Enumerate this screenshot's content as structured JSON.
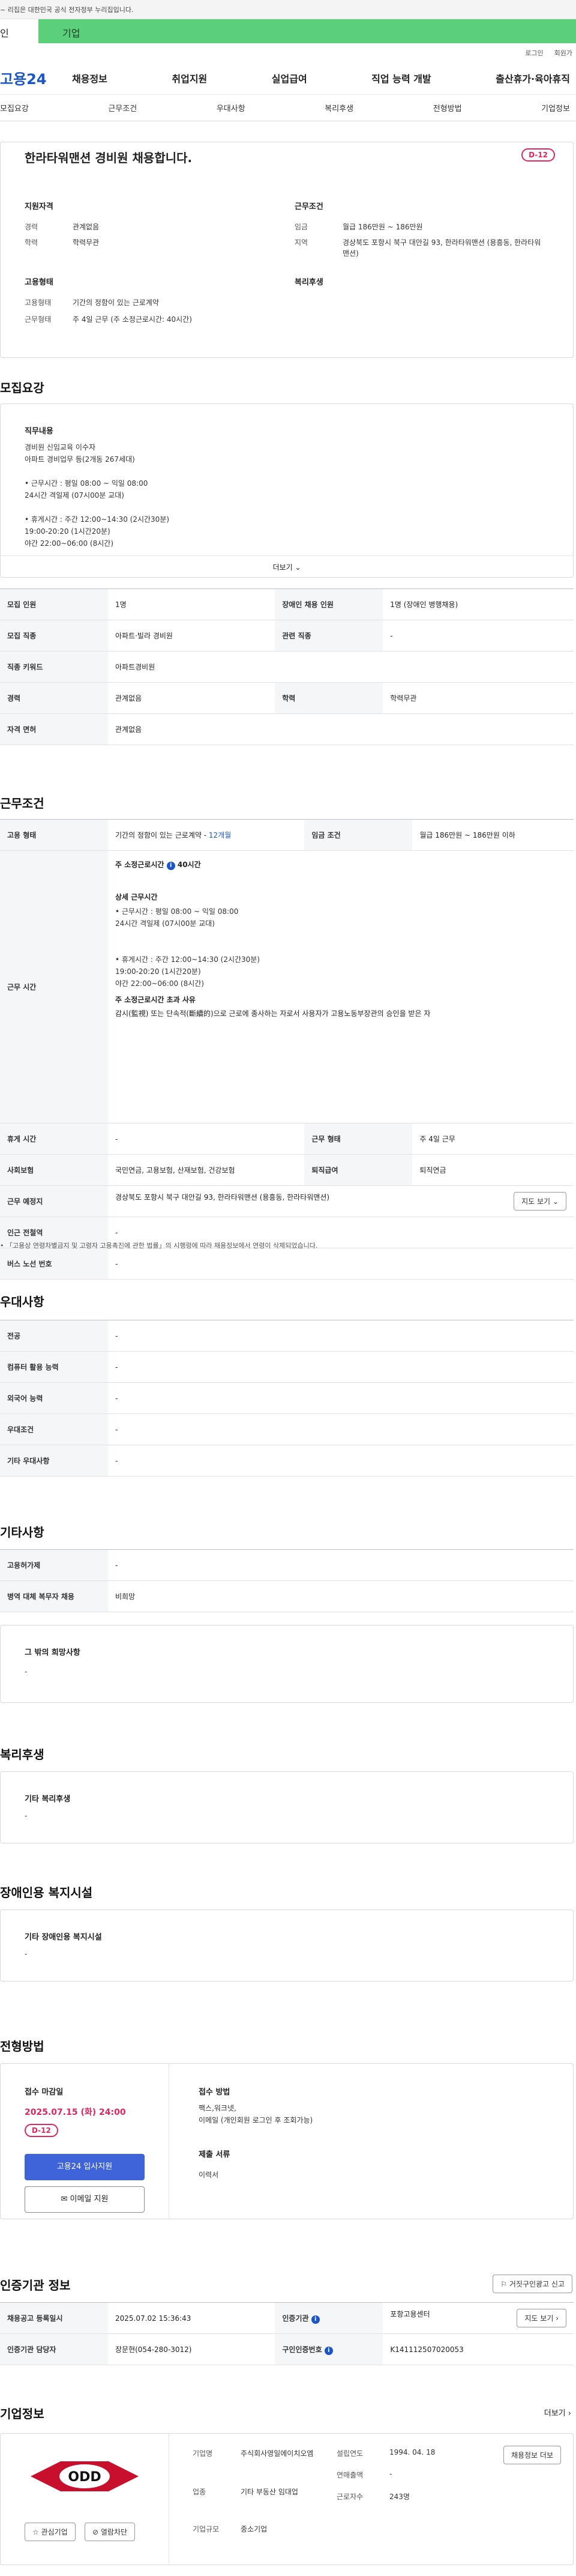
{
  "govbar": {
    "text": "~ 리집은 대한민국 공식 전자정부 누리집입니다."
  },
  "top_tabs": [
    "인",
    "기업"
  ],
  "util": [
    "로그인",
    "회원가"
  ],
  "gnb": {
    "logo": "고용24",
    "menu": [
      "채용정보",
      "취업지원",
      "실업급여",
      "직업 능력 개발",
      "출산휴가·육아휴직"
    ]
  },
  "subnav": [
    "모집요강",
    "근무조건",
    "우대사항",
    "복리후생",
    "전형방법",
    "기업정보"
  ],
  "summary": {
    "title": "한라타워맨션 경비원 채용합니다.",
    "dday": "D-12",
    "qual_title": "지원자격",
    "qual": [
      {
        "k": "경력",
        "v": "관계없음"
      },
      {
        "k": "학력",
        "v": "학력무관"
      }
    ],
    "cond_title": "근무조건",
    "cond": [
      {
        "k": "임금",
        "v": "월급 186만원 ~ 186만원"
      },
      {
        "k": "지역",
        "v": "경상북도 포항시 북구 대안길 93, 한라타워맨션 (용흥동, 한라타워맨션)"
      }
    ],
    "emp_title": "고용형태",
    "emp": [
      {
        "k": "고용형태",
        "v": "기간의 정함이 있는 근로계약"
      },
      {
        "k": "근무형태",
        "v": "주 4일 근무 (주 소정근로시간: 40시간)"
      }
    ],
    "welfare_title": "복리후생"
  },
  "recruit": {
    "title": "모집요강",
    "duty_title": "직무내용",
    "duty_text": "경비원 신임교육 이수자\n아파트 경비업무 등(2개동 267세대)\n\n• 근무시간 : 평일 08:00 ~ 익일 08:00\n             24시간 격일제 (07시00분 교대)\n\n• 휴게시간 : 주간 12:00~14:30 (2시간30분)\n                  19:00-20:20 (1시간20분)\n           야간  22:00~06:00 (8시간)",
    "more": "더보기",
    "rows": [
      [
        {
          "k": "모집 인원",
          "v": "1명"
        },
        {
          "k": "장애인 채용 인원",
          "v": "1명 (장애인 병행채용)"
        }
      ],
      [
        {
          "k": "모집 직종",
          "v": "아파트·빌라 경비원"
        },
        {
          "k": "관련 직종",
          "v": "-"
        }
      ],
      [
        {
          "k": "직종 키워드",
          "v": "아파트경비원"
        }
      ],
      [
        {
          "k": "경력",
          "v": "관계없음"
        },
        {
          "k": "학력",
          "v": "학력무관"
        }
      ],
      [
        {
          "k": "자격 면허",
          "v": "관계없음"
        }
      ]
    ]
  },
  "work": {
    "title": "근무조건",
    "emp_k": "고용 형태",
    "emp_v": "기간의 정함이 있는 근로계약 -",
    "emp_v2": "12개월",
    "wage_k": "임금 조건",
    "wage_v": "월급 186만원 ~ 186만원 이하",
    "time_k": "근무 시간",
    "time_head": "주 소정근로시간",
    "time_head2": "40시간",
    "time_detail_title": "상세 근무시간",
    "time_detail": "• 근무시간 : 평일 08:00 ~ 익일 08:00\n             24시간 격일제 (07시00분 교대)\n\n\n• 휴게시간 : 주간 12:00~14:30 (2시간30분)\n                  19:00-20:20 (1시간20분)\n           야간  22:00~06:00 (8시간)",
    "over_title": "주 소정근로시간 초과 사유",
    "over_text": "감시(監視) 또는 단속적(斷續的)으로 근로에 종사하는 자로서 사용자가 고용노동부장관의 승인을 받은 자",
    "rows": [
      [
        {
          "k": "휴게 시간",
          "v": "-"
        },
        {
          "k": "근무 형태",
          "v": "주 4일 근무"
        }
      ],
      [
        {
          "k": "사회보험",
          "v": "국민연금, 고용보험, 산재보험, 건강보험"
        },
        {
          "k": "퇴직급여",
          "v": "퇴직연금"
        }
      ]
    ],
    "place_k": "근무 예정지",
    "place_v": "경상북도 포항시 북구 대안길 93, 한라타워맨션 (용흥동, 한라타워맨션)",
    "map_btn": "지도 보기",
    "station_k": "인근 전철역",
    "station_v": "-",
    "bus_k": "버스 노선 번호",
    "bus_v": "-",
    "note": "• 「고용상 연령차별금지 및 고령자 고용촉진에 관한 법률」의 시행령에 따라 채용정보에서 연령이 삭제되었습니다."
  },
  "pref": {
    "title": "우대사항",
    "rows": [
      {
        "k": "전공",
        "v": "-"
      },
      {
        "k": "컴퓨터 활용 능력",
        "v": "-"
      },
      {
        "k": "외국어 능력",
        "v": "-"
      },
      {
        "k": "우대조건",
        "v": "-"
      },
      {
        "k": "기타 우대사항",
        "v": "-"
      }
    ]
  },
  "etc": {
    "title": "기타사항",
    "rows": [
      {
        "k": "고용허가제",
        "v": "-"
      },
      {
        "k": "병역 대체 복무자 채용",
        "v": "비희망"
      }
    ],
    "other_title": "그 밖의 희망사항",
    "other_v": "-"
  },
  "welfare": {
    "title": "복리후생",
    "box_title": "기타 복리후생",
    "box_v": "-"
  },
  "disabled": {
    "title": "장애인용 복지시설",
    "box_title": "기타 장애인용 복지시설",
    "box_v": "-"
  },
  "apply": {
    "title": "전형방법",
    "deadline_title": "접수 마감일",
    "deadline": "2025.07.15 (화) 24:00",
    "dday": "D-12",
    "apply_btn": "고용24 입사지원",
    "email_btn": "이메일 지원",
    "method_title": "접수 방법",
    "method": "팩스,워크넷,\n이메일 (개인회원 로그인 후 조회가능)",
    "docs_title": "제출 서류",
    "docs": "이력서"
  },
  "agency": {
    "title": "인증기관 정보",
    "report_btn": "거짓구인광고 신고",
    "reg_k": "채용공고 등록일시",
    "reg_v": "2025.07.02 15:36:43",
    "org_k": "인증기관",
    "org_v": "포항고용센터",
    "map_btn": "지도 보기",
    "mgr_k": "인증기관 담당자",
    "mgr_v": "장문현(054-280-3012)",
    "id_k": "구인인증번호",
    "id_v": "K141112507020053"
  },
  "company": {
    "title": "기업정보",
    "more": "더보기",
    "logo_text": "ODD",
    "fav_btn": "관심기업",
    "follow_btn": "열람차단",
    "fields": [
      {
        "k": "기업명",
        "v": "주식회사영일에이치오엠"
      },
      {
        "k": "업종",
        "v": "기타 부동산 임대업"
      },
      {
        "k": "기업규모",
        "v": "중소기업"
      }
    ],
    "fields2": [
      {
        "k": "설립연도",
        "v": "1994. 04. 18"
      },
      {
        "k": "연매출액",
        "v": "-"
      },
      {
        "k": "근로자수",
        "v": "243명"
      }
    ],
    "jobs_btn": "채용정보 더보"
  },
  "colors": {
    "brand": "#1a56c7",
    "accent": "#e0245e",
    "tab": "#5ccf7b"
  }
}
